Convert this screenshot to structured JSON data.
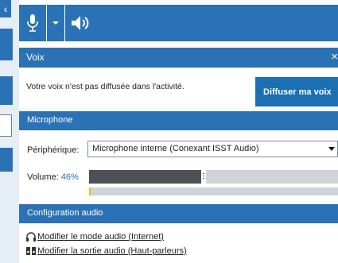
{
  "toolbar": {
    "mic_icon": "microphone-icon",
    "dropdown_icon": "chevron-down-icon",
    "speaker_icon": "speaker-icon"
  },
  "panel": {
    "title": "Voix",
    "close_glyph": "×"
  },
  "status": {
    "message": "Votre voix n'est pas diffusée dans l'activité.",
    "broadcast_button": "Diffuser ma voix"
  },
  "microphone": {
    "section_title": "Microphone",
    "device_label": "Périphérique:",
    "device_value": "Microphone interne (Conexant ISST Audio)",
    "volume_label": "Volume:",
    "volume_value": "46%",
    "volume_percent": 46,
    "input_level_percent": 0
  },
  "audio_config": {
    "section_title": "Configuration audio",
    "links": [
      {
        "label": "Modifier le mode audio (Internet)",
        "icon": "headset-icon"
      },
      {
        "label": "Modifier la sortie audio (Haut-parleurs)",
        "icon": "speakers-icon"
      }
    ]
  },
  "colors": {
    "accent": "#2a72b5",
    "volume_fill": "#4d5157",
    "level_marker": "#f2c200"
  }
}
